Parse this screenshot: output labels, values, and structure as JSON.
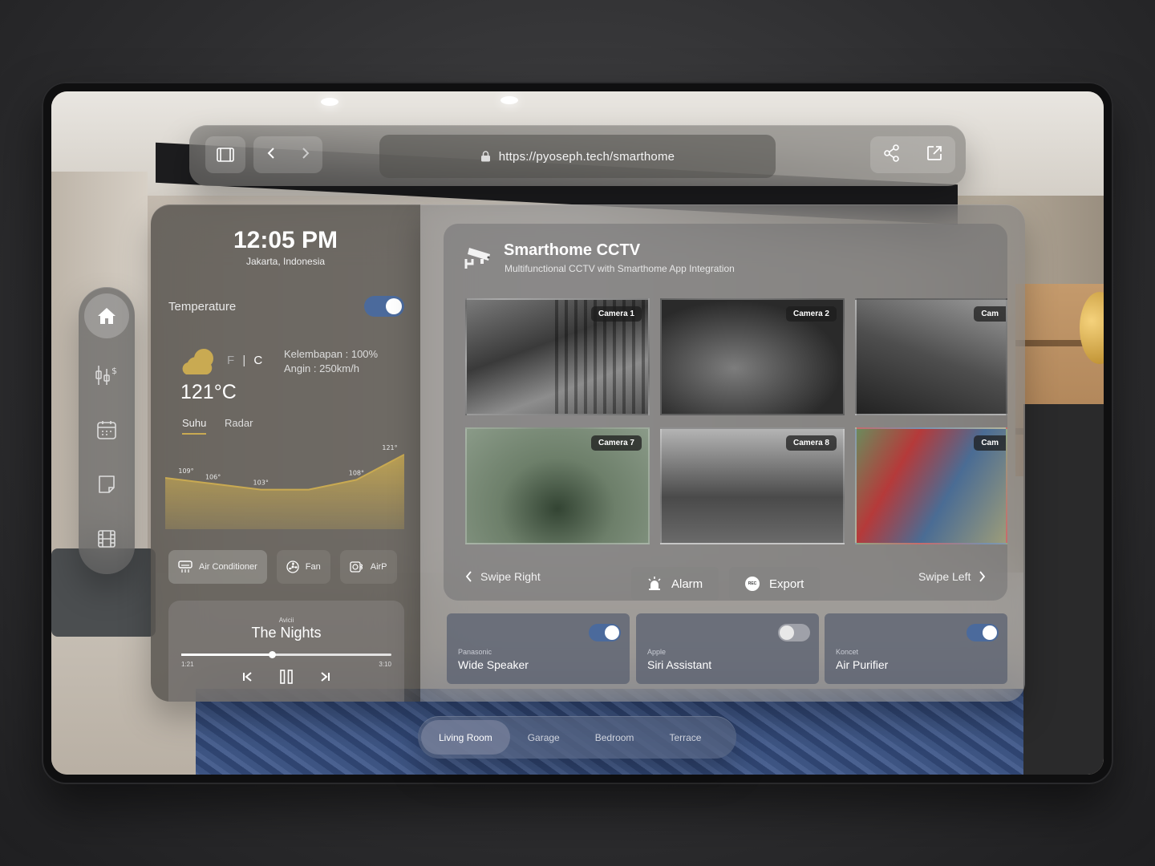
{
  "browser": {
    "url": "https://pyoseph.tech/smarthome"
  },
  "weather": {
    "time": "12:05 PM",
    "location": "Jakarta, Indonesia",
    "temperature_label": "Temperature",
    "temperature_toggle": true,
    "unit_f": "F",
    "unit_sep": "|",
    "unit_c": "C",
    "humidity": "Kelembapan : 100%",
    "wind": "Angin : 250km/h",
    "current_temp": "121°C",
    "tabs": [
      "Suhu",
      "Radar"
    ],
    "active_tab": "Suhu"
  },
  "chart_data": {
    "type": "area",
    "x": [
      0,
      1,
      2,
      3,
      4,
      5
    ],
    "values": [
      109,
      106,
      103,
      103,
      108,
      121
    ],
    "labels": [
      "109°",
      "106°",
      "103°",
      "",
      "108°",
      "121°"
    ],
    "ylim": [
      95,
      123
    ],
    "color": "#c9aa52"
  },
  "appliances": [
    {
      "label": "Air Conditioner",
      "icon": "air-conditioner-icon",
      "active": true
    },
    {
      "label": "Fan",
      "icon": "fan-icon",
      "active": false
    },
    {
      "label": "AirP",
      "icon": "air-purifier-icon",
      "active": false
    }
  ],
  "player": {
    "artist": "Avicii",
    "song": "The Nights",
    "elapsed": "1:21",
    "duration": "3:10",
    "progress": 0.43
  },
  "cctv": {
    "title": "Smarthome CCTV",
    "subtitle": "Multifunctional CCTV with Smarthome App Integration",
    "cameras": [
      {
        "label": "Camera 1"
      },
      {
        "label": "Camera 2"
      },
      {
        "label": "Cam"
      },
      {
        "label": "Camera 7"
      },
      {
        "label": "Camera 8"
      },
      {
        "label": "Cam"
      }
    ],
    "swipe_right": "Swipe Right",
    "swipe_left": "Swipe Left",
    "alarm": "Alarm",
    "export": "Export",
    "rec": "REC"
  },
  "devices": [
    {
      "brand": "Panasonic",
      "name": "Wide Speaker",
      "on": true
    },
    {
      "brand": "Apple",
      "name": "Siri Assistant",
      "on": false
    },
    {
      "brand": "Koncet",
      "name": "Air Purifier",
      "on": true
    }
  ],
  "rooms": [
    "Living Room",
    "Garage",
    "Bedroom",
    "Terrace"
  ],
  "active_room": "Living Room"
}
